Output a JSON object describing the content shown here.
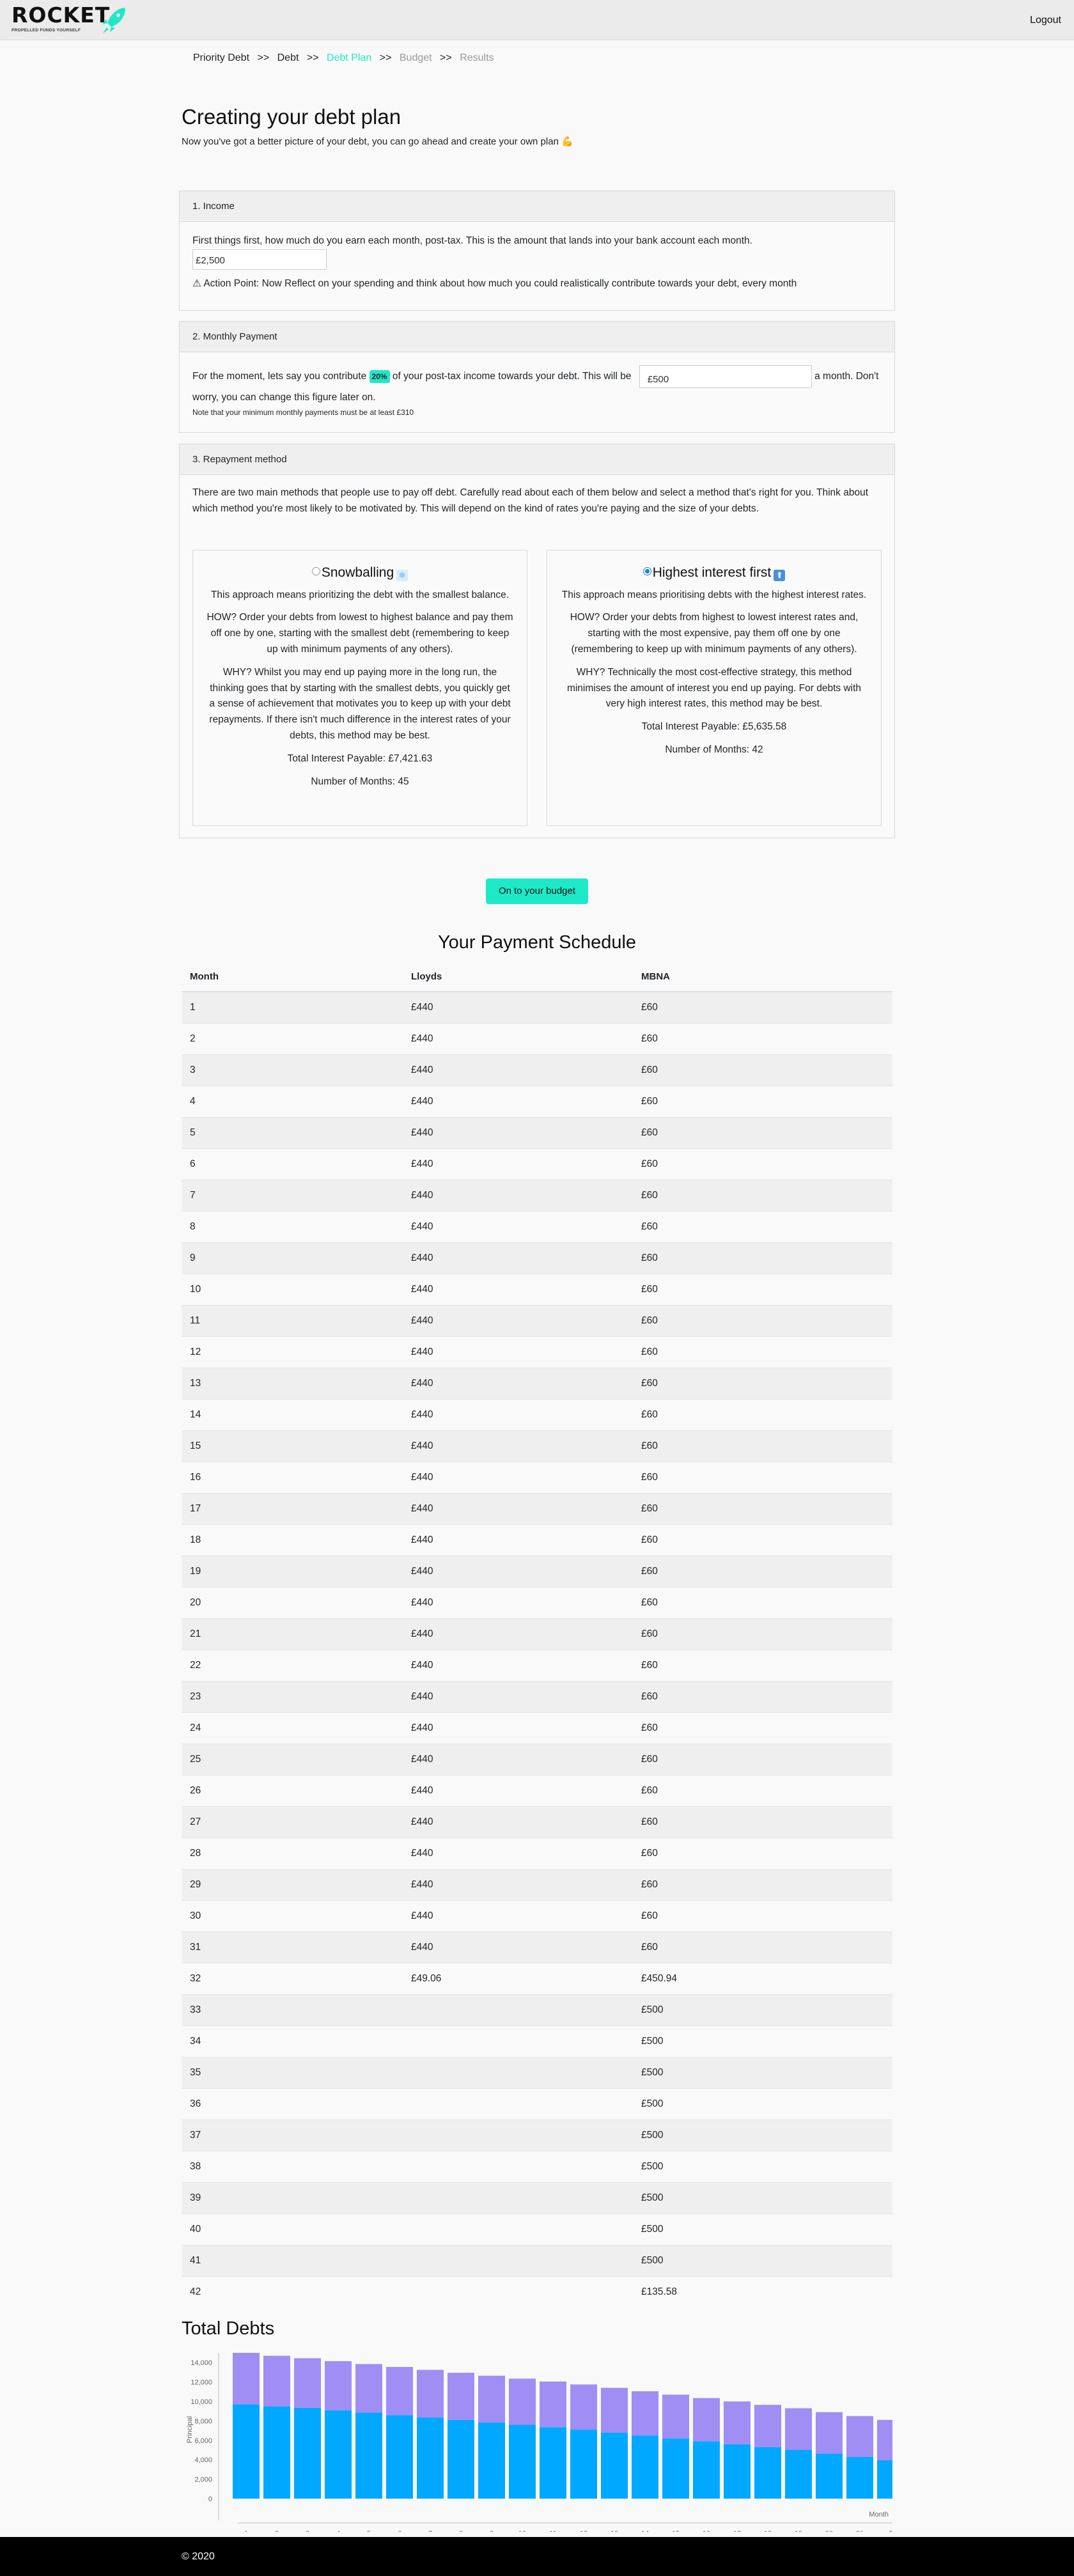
{
  "header": {
    "logo": "ROCKET",
    "tagline": "PROPELLED FUNDS YOURSELF",
    "logout": "Logout"
  },
  "breadcrumb": [
    {
      "label": "Priority Debt",
      "state": "done"
    },
    {
      "label": "Debt",
      "state": "done"
    },
    {
      "label": "Debt Plan",
      "state": "current"
    },
    {
      "label": "Budget",
      "state": "todo"
    },
    {
      "label": "Results",
      "state": "todo"
    }
  ],
  "breadcrumb_sep": ">>",
  "page": {
    "title": "Creating your debt plan",
    "subtitle": "Now you've got a better picture of your debt, you can go ahead and create your own plan 💪"
  },
  "income": {
    "heading": "1. Income",
    "text": "First things first, how much do you earn each month, post-tax. This is the amount that lands into your bank account each month.",
    "value": "£2,500",
    "action": "⚠ Action Point: Now Reflect on your spending and think about how much you could realistically contribute towards your debt, every month"
  },
  "payment": {
    "heading": "2. Monthly Payment",
    "text_a": "For the moment, lets say you contribute",
    "pct": "20%",
    "text_b": "of your post-tax income towards your debt. This will be",
    "value": "£500",
    "text_c": "a month. Don't worry, you can change this figure later on.",
    "note": "Note that your minimum monthly payments must be at least £310"
  },
  "repayment": {
    "heading": "3. Repayment method",
    "intro": "There are two main methods that people use to pay off debt. Carefully read about each of them below and select a method that's right for you. Think about which method you're most likely to be motivated by. This will depend on the kind of rates you're paying and the size of your debts.",
    "methods": [
      {
        "title": "Snowballing",
        "selected": false,
        "desc": "This approach means prioritizing the debt with the smallest balance.",
        "how": "HOW? Order your debts from lowest to highest balance and pay them off one by one, starting with the smallest debt (remembering to keep up with minimum payments of any others).",
        "why": "WHY? Whilst you may end up paying more in the long run, the thinking goes that by starting with the smallest debts, you quickly get a sense of achievement that motivates you to keep up with your debt repayments. If there isn't much difference in the interest rates of your debts, this method may be best.",
        "interest": "Total Interest Payable: £7,421.63",
        "months": "Number of Months: 45"
      },
      {
        "title": "Highest interest first",
        "selected": true,
        "desc": "This approach means prioritising debts with the highest interest rates.",
        "how": "HOW? Order your debts from highest to lowest interest rates and, starting with the most expensive, pay them off one by one (remembering to keep up with minimum payments of any others).",
        "why": "WHY? Technically the most cost-effective strategy, this method minimises the amount of interest you end up paying. For debts with very high interest rates, this method may be best.",
        "interest": "Total Interest Payable: £5,635.58",
        "months": "Number of Months: 42"
      }
    ]
  },
  "cta": "On to your budget",
  "schedule": {
    "title": "Your Payment Schedule",
    "columns": [
      "Month",
      "Lloyds",
      "MBNA"
    ],
    "rows": [
      [
        "1",
        "£440",
        "£60"
      ],
      [
        "2",
        "£440",
        "£60"
      ],
      [
        "3",
        "£440",
        "£60"
      ],
      [
        "4",
        "£440",
        "£60"
      ],
      [
        "5",
        "£440",
        "£60"
      ],
      [
        "6",
        "£440",
        "£60"
      ],
      [
        "7",
        "£440",
        "£60"
      ],
      [
        "8",
        "£440",
        "£60"
      ],
      [
        "9",
        "£440",
        "£60"
      ],
      [
        "10",
        "£440",
        "£60"
      ],
      [
        "11",
        "£440",
        "£60"
      ],
      [
        "12",
        "£440",
        "£60"
      ],
      [
        "13",
        "£440",
        "£60"
      ],
      [
        "14",
        "£440",
        "£60"
      ],
      [
        "15",
        "£440",
        "£60"
      ],
      [
        "16",
        "£440",
        "£60"
      ],
      [
        "17",
        "£440",
        "£60"
      ],
      [
        "18",
        "£440",
        "£60"
      ],
      [
        "19",
        "£440",
        "£60"
      ],
      [
        "20",
        "£440",
        "£60"
      ],
      [
        "21",
        "£440",
        "£60"
      ],
      [
        "22",
        "£440",
        "£60"
      ],
      [
        "23",
        "£440",
        "£60"
      ],
      [
        "24",
        "£440",
        "£60"
      ],
      [
        "25",
        "£440",
        "£60"
      ],
      [
        "26",
        "£440",
        "£60"
      ],
      [
        "27",
        "£440",
        "£60"
      ],
      [
        "28",
        "£440",
        "£60"
      ],
      [
        "29",
        "£440",
        "£60"
      ],
      [
        "30",
        "£440",
        "£60"
      ],
      [
        "31",
        "£440",
        "£60"
      ],
      [
        "32",
        "£49.06",
        "£450.94"
      ],
      [
        "33",
        "",
        "£500"
      ],
      [
        "34",
        "",
        "£500"
      ],
      [
        "35",
        "",
        "£500"
      ],
      [
        "36",
        "",
        "£500"
      ],
      [
        "37",
        "",
        "£500"
      ],
      [
        "38",
        "",
        "£500"
      ],
      [
        "39",
        "",
        "£500"
      ],
      [
        "40",
        "",
        "£500"
      ],
      [
        "41",
        "",
        "£500"
      ],
      [
        "42",
        "",
        "£135.58"
      ]
    ]
  },
  "totals_title": "Total Debts",
  "chart_data": {
    "type": "bar",
    "stacked": true,
    "xlabel": "Month",
    "ylabel": "Principal",
    "ylim": [
      0,
      15000
    ],
    "yticks": [
      "0",
      "2,000",
      "4,000",
      "6,000",
      "8,000",
      "10,000",
      "12,000",
      "14,000"
    ],
    "categories": [
      "1",
      "2",
      "3",
      "4",
      "5",
      "6",
      "7",
      "8",
      "9",
      "10",
      "11",
      "12",
      "13",
      "14",
      "15",
      "16",
      "17",
      "18",
      "19",
      "20",
      "21",
      "2"
    ],
    "series": [
      {
        "color": "#00a8ff",
        "values": [
          9700,
          9500,
          9350,
          9100,
          8850,
          8600,
          8350,
          8100,
          7850,
          7600,
          7350,
          7100,
          6800,
          6500,
          6200,
          5900,
          5600,
          5300,
          5000,
          4650,
          4300,
          3950
        ]
      },
      {
        "color": "#a08ef5",
        "values": [
          5300,
          5200,
          5100,
          5050,
          5000,
          4950,
          4900,
          4850,
          4800,
          4750,
          4700,
          4650,
          4600,
          4550,
          4500,
          4450,
          4400,
          4350,
          4300,
          4250,
          4200,
          4150
        ]
      }
    ]
  },
  "footer": "© 2020"
}
